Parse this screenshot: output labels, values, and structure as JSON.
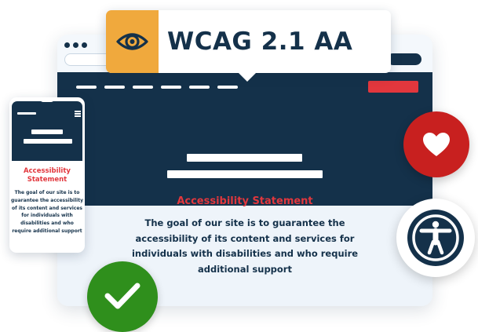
{
  "banner": {
    "title": "WCAG 2.1 AA",
    "icon": "eye-icon"
  },
  "page": {
    "heading": "Accessibility Statement",
    "body": "The goal of our site is to guarantee the accessibility of its content and services for individuals with disabilities and who require additional support"
  },
  "phone": {
    "heading": "Accessibility Statement",
    "body": "The goal of our site is to guarantee the accessibility of its content and services for individuals with disabilities and who require additional support"
  },
  "badges": {
    "heart": "heart-icon",
    "accessibility": "accessibility-icon",
    "check": "check-icon"
  },
  "colors": {
    "navy": "#14314a",
    "accent_red": "#e2373d",
    "heart_red": "#c8201f",
    "orange": "#f0a93d",
    "green": "#2f8f1c",
    "content_bg": "#eef4fa"
  }
}
